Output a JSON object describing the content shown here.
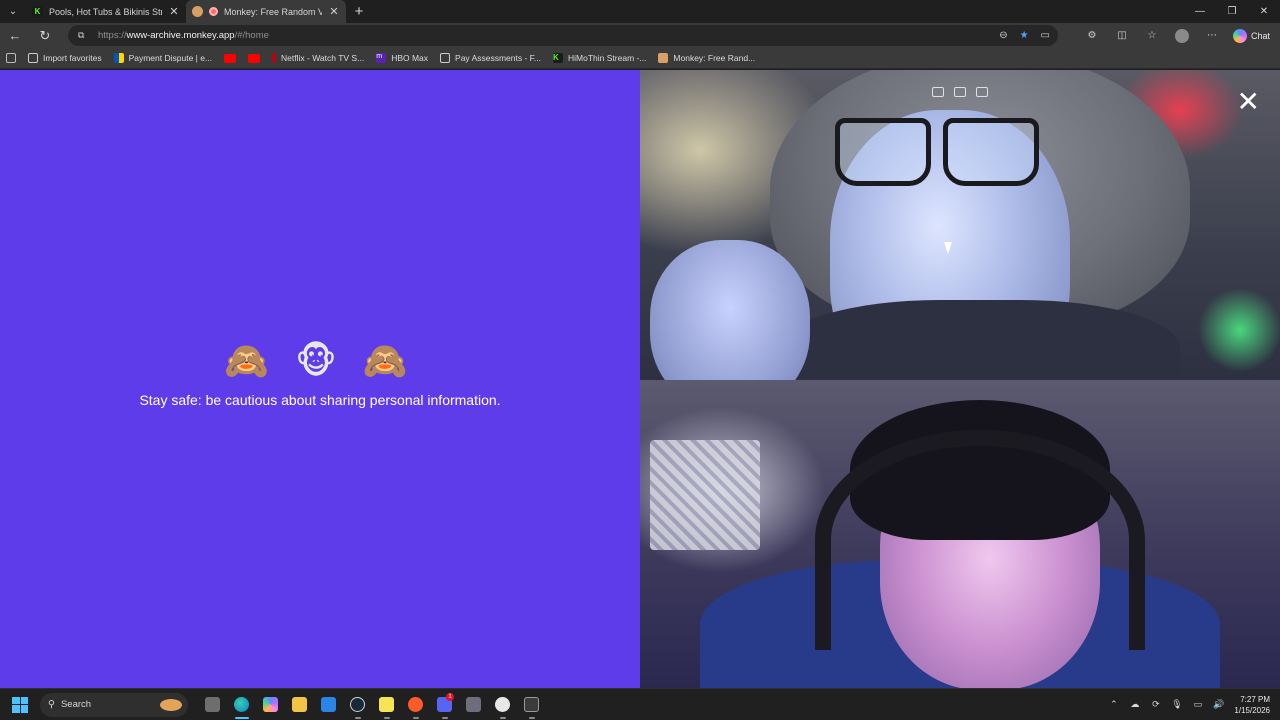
{
  "browser": {
    "tabs": [
      {
        "title": "Pools, Hot Tubs & Bikinis Stream",
        "close": "✕",
        "active": false
      },
      {
        "title": "Monkey: Free Random Video",
        "close": "✕",
        "active": true
      }
    ],
    "new_tab": "+",
    "window_controls": {
      "minimize": "—",
      "maximize": "❐",
      "close": "✕"
    },
    "address": {
      "scheme": "https://",
      "host": "www-archive.monkey.app",
      "path": "/#/home"
    },
    "chat_label": "Chat",
    "bookmarks": [
      {
        "label": "Import favorites",
        "icon": "import-icon"
      },
      {
        "label": "Payment Dispute | e...",
        "icon": "payment-flag-icon"
      },
      {
        "label": "",
        "icon": "youtube-icon"
      },
      {
        "label": "",
        "icon": "youtube-icon"
      },
      {
        "label": "Netflix - Watch TV S...",
        "icon": "netflix-icon"
      },
      {
        "label": "HBO Max",
        "icon": "hbo-icon"
      },
      {
        "label": "Pay Assessments - F...",
        "icon": "globe-icon"
      },
      {
        "label": "HiMoThin Stream -...",
        "icon": "kick-icon"
      },
      {
        "label": "Monkey: Free Rand...",
        "icon": "monkey-icon"
      }
    ]
  },
  "page": {
    "monkeys": "🙈 🐵 🙈",
    "safety_message": "Stay safe: be cautious about sharing personal information.",
    "close_label": "✕",
    "colors": {
      "background": "#5e3cea",
      "text": "#ffffff"
    }
  },
  "taskbar": {
    "search_placeholder": "Search",
    "time": "7:27 PM",
    "date": "1/15/2026",
    "discord_badge": "1"
  }
}
